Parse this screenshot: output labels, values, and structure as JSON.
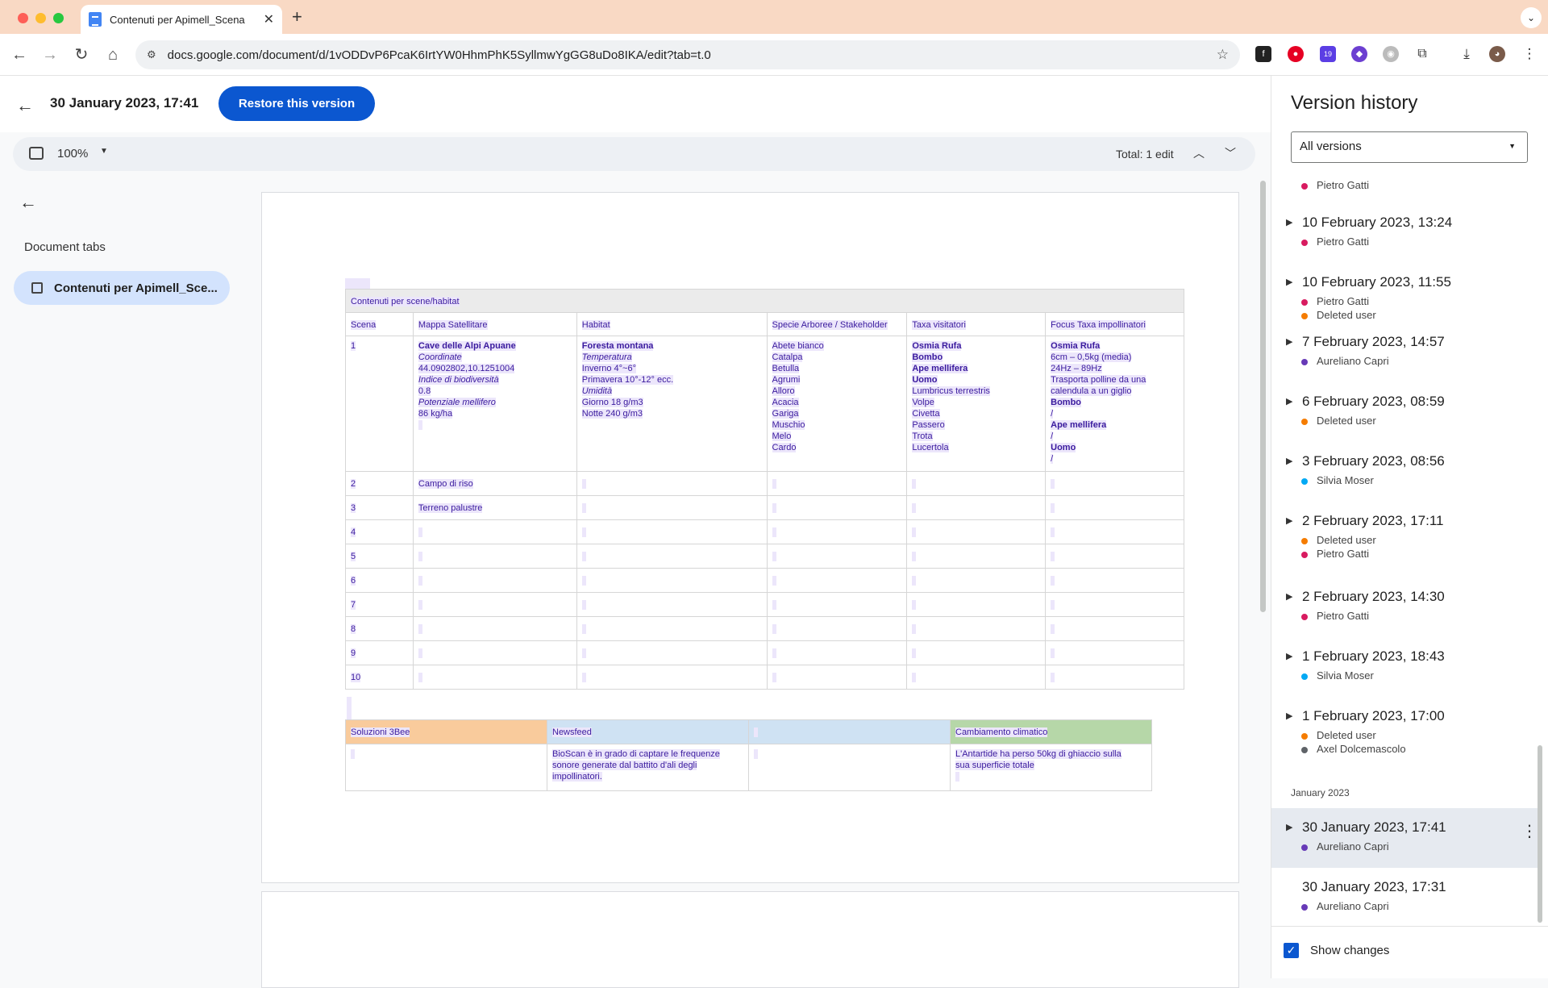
{
  "browser": {
    "tab_title": "Contenuti per Apimell_Scena",
    "url": "docs.google.com/document/d/1vODDvP6PcaK6IrtYW0HhmPhK5SyllmwYgGG8uDo8IKA/edit?tab=t.0",
    "extension_badge": "19"
  },
  "header": {
    "version_title": "30 January 2023, 17:41",
    "restore_label": "Restore this version"
  },
  "subbar": {
    "zoom": "100%",
    "total_edits": "Total: 1 edit"
  },
  "tabs_panel": {
    "label": "Document tabs",
    "active_tab": "Contenuti per Apimell_Sce..."
  },
  "table1": {
    "title": "Contenuti per scene/habitat",
    "headers": [
      "Scena",
      "Mappa Satellitare",
      "Habitat",
      "Specie Arboree / Stakeholder",
      "Taxa visitatori",
      "Focus Taxa impollinatori"
    ],
    "row1": {
      "scena": "1",
      "mappa": [
        {
          "t": "Cave delle Alpi Apuane",
          "s": "b"
        },
        {
          "t": "Coordinate",
          "s": "i"
        },
        {
          "t": "44.0902802,10.1251004",
          "s": ""
        },
        {
          "t": "Indice di biodiversità",
          "s": "i"
        },
        {
          "t": "0.8",
          "s": ""
        },
        {
          "t": "Potenziale mellifero",
          "s": "i"
        },
        {
          "t": "86 kg/ha",
          "s": ""
        }
      ],
      "habitat": [
        {
          "t": "Foresta montana",
          "s": "b"
        },
        {
          "t": "Temperatura",
          "s": "i"
        },
        {
          "t": "Inverno 4°~6°",
          "s": ""
        },
        {
          "t": "Primavera 10°-12° ecc.",
          "s": ""
        },
        {
          "t": "Umidità",
          "s": "i"
        },
        {
          "t": "Giorno 18 g/m3",
          "s": ""
        },
        {
          "t": "Notte 240 g/m3",
          "s": ""
        }
      ],
      "specie": [
        "Abete bianco",
        "Catalpa",
        "Betulla",
        "Agrumi",
        "Alloro",
        "Acacia",
        "Gariga",
        "Muschio",
        "Melo",
        "Cardo"
      ],
      "taxa": [
        {
          "t": "Osmia Rufa",
          "s": "b"
        },
        {
          "t": "Bombo",
          "s": "b"
        },
        {
          "t": "Ape mellifera",
          "s": "b"
        },
        {
          "t": "Uomo",
          "s": "b"
        },
        {
          "t": "Lumbricus terrestris",
          "s": ""
        },
        {
          "t": "Volpe",
          "s": ""
        },
        {
          "t": "Civetta",
          "s": ""
        },
        {
          "t": "Passero",
          "s": ""
        },
        {
          "t": "Trota",
          "s": ""
        },
        {
          "t": "Lucertola",
          "s": ""
        }
      ],
      "focus": [
        {
          "t": "Osmia Rufa",
          "s": "b"
        },
        {
          "t": "6cm – 0,5kg (media)",
          "s": ""
        },
        {
          "t": "24Hz – 89Hz",
          "s": ""
        },
        {
          "t": "Trasporta polline da una",
          "s": ""
        },
        {
          "t": "calendula a un giglio",
          "s": ""
        },
        {
          "t": "Bombo",
          "s": "b"
        },
        {
          "t": "/",
          "s": ""
        },
        {
          "t": "Ape mellifera",
          "s": "b"
        },
        {
          "t": "/",
          "s": ""
        },
        {
          "t": "Uomo",
          "s": "b"
        },
        {
          "t": "/",
          "s": ""
        }
      ]
    },
    "rows": [
      {
        "n": "2",
        "mappa": "Campo di riso"
      },
      {
        "n": "3",
        "mappa": "Terreno palustre"
      },
      {
        "n": "4",
        "mappa": ""
      },
      {
        "n": "5",
        "mappa": ""
      },
      {
        "n": "6",
        "mappa": ""
      },
      {
        "n": "7",
        "mappa": ""
      },
      {
        "n": "8",
        "mappa": ""
      },
      {
        "n": "9",
        "mappa": ""
      },
      {
        "n": "10",
        "mappa": ""
      }
    ]
  },
  "table2": {
    "headers": [
      "Soluzioni 3Bee",
      "Newsfeed",
      "",
      "Cambiamento climatico"
    ],
    "header_colors": [
      "#f9cb9c",
      "#cfe2f3",
      "#cfe2f3",
      "#b6d7a8"
    ],
    "cells": [
      [],
      [
        "BioScan è in grado di captare le frequenze",
        "sonore generate dal battito d'ali degli",
        "impollinatori."
      ],
      [],
      [
        "L'Antartide ha perso 50kg di ghiaccio sulla",
        "sua superficie totale"
      ]
    ]
  },
  "version_history": {
    "title": "Version history",
    "filter": "All versions",
    "month_label": "January 2023",
    "show_changes": "Show changes",
    "colors": {
      "Pietro Gatti": "#d81b60",
      "Deleted user": "#f57c00",
      "Aureliano Capri": "#673ab7",
      "Silvia Moser": "#03a9f4",
      "Axel Dolcemascolo": "#5f6368"
    },
    "top_user": "Pietro Gatti",
    "versions": [
      {
        "date": "10 February 2023, 13:24",
        "users": [
          "Pietro Gatti"
        ]
      },
      {
        "date": "10 February 2023, 11:55",
        "users": [
          "Pietro Gatti",
          "Deleted user"
        ]
      },
      {
        "date": "7 February 2023, 14:57",
        "users": [
          "Aureliano Capri"
        ]
      },
      {
        "date": "6 February 2023, 08:59",
        "users": [
          "Deleted user"
        ]
      },
      {
        "date": "3 February 2023, 08:56",
        "users": [
          "Silvia Moser"
        ]
      },
      {
        "date": "2 February 2023, 17:11",
        "users": [
          "Deleted user",
          "Pietro Gatti"
        ]
      },
      {
        "date": "2 February 2023, 14:30",
        "users": [
          "Pietro Gatti"
        ]
      },
      {
        "date": "1 February 2023, 18:43",
        "users": [
          "Silvia Moser"
        ]
      },
      {
        "date": "1 February 2023, 17:00",
        "users": [
          "Deleted user",
          "Axel Dolcemascolo"
        ]
      },
      {
        "date": "30 January 2023, 17:41",
        "users": [
          "Aureliano Capri"
        ]
      },
      {
        "date": "30 January 2023, 17:31",
        "users": [
          "Aureliano Capri"
        ]
      }
    ]
  }
}
